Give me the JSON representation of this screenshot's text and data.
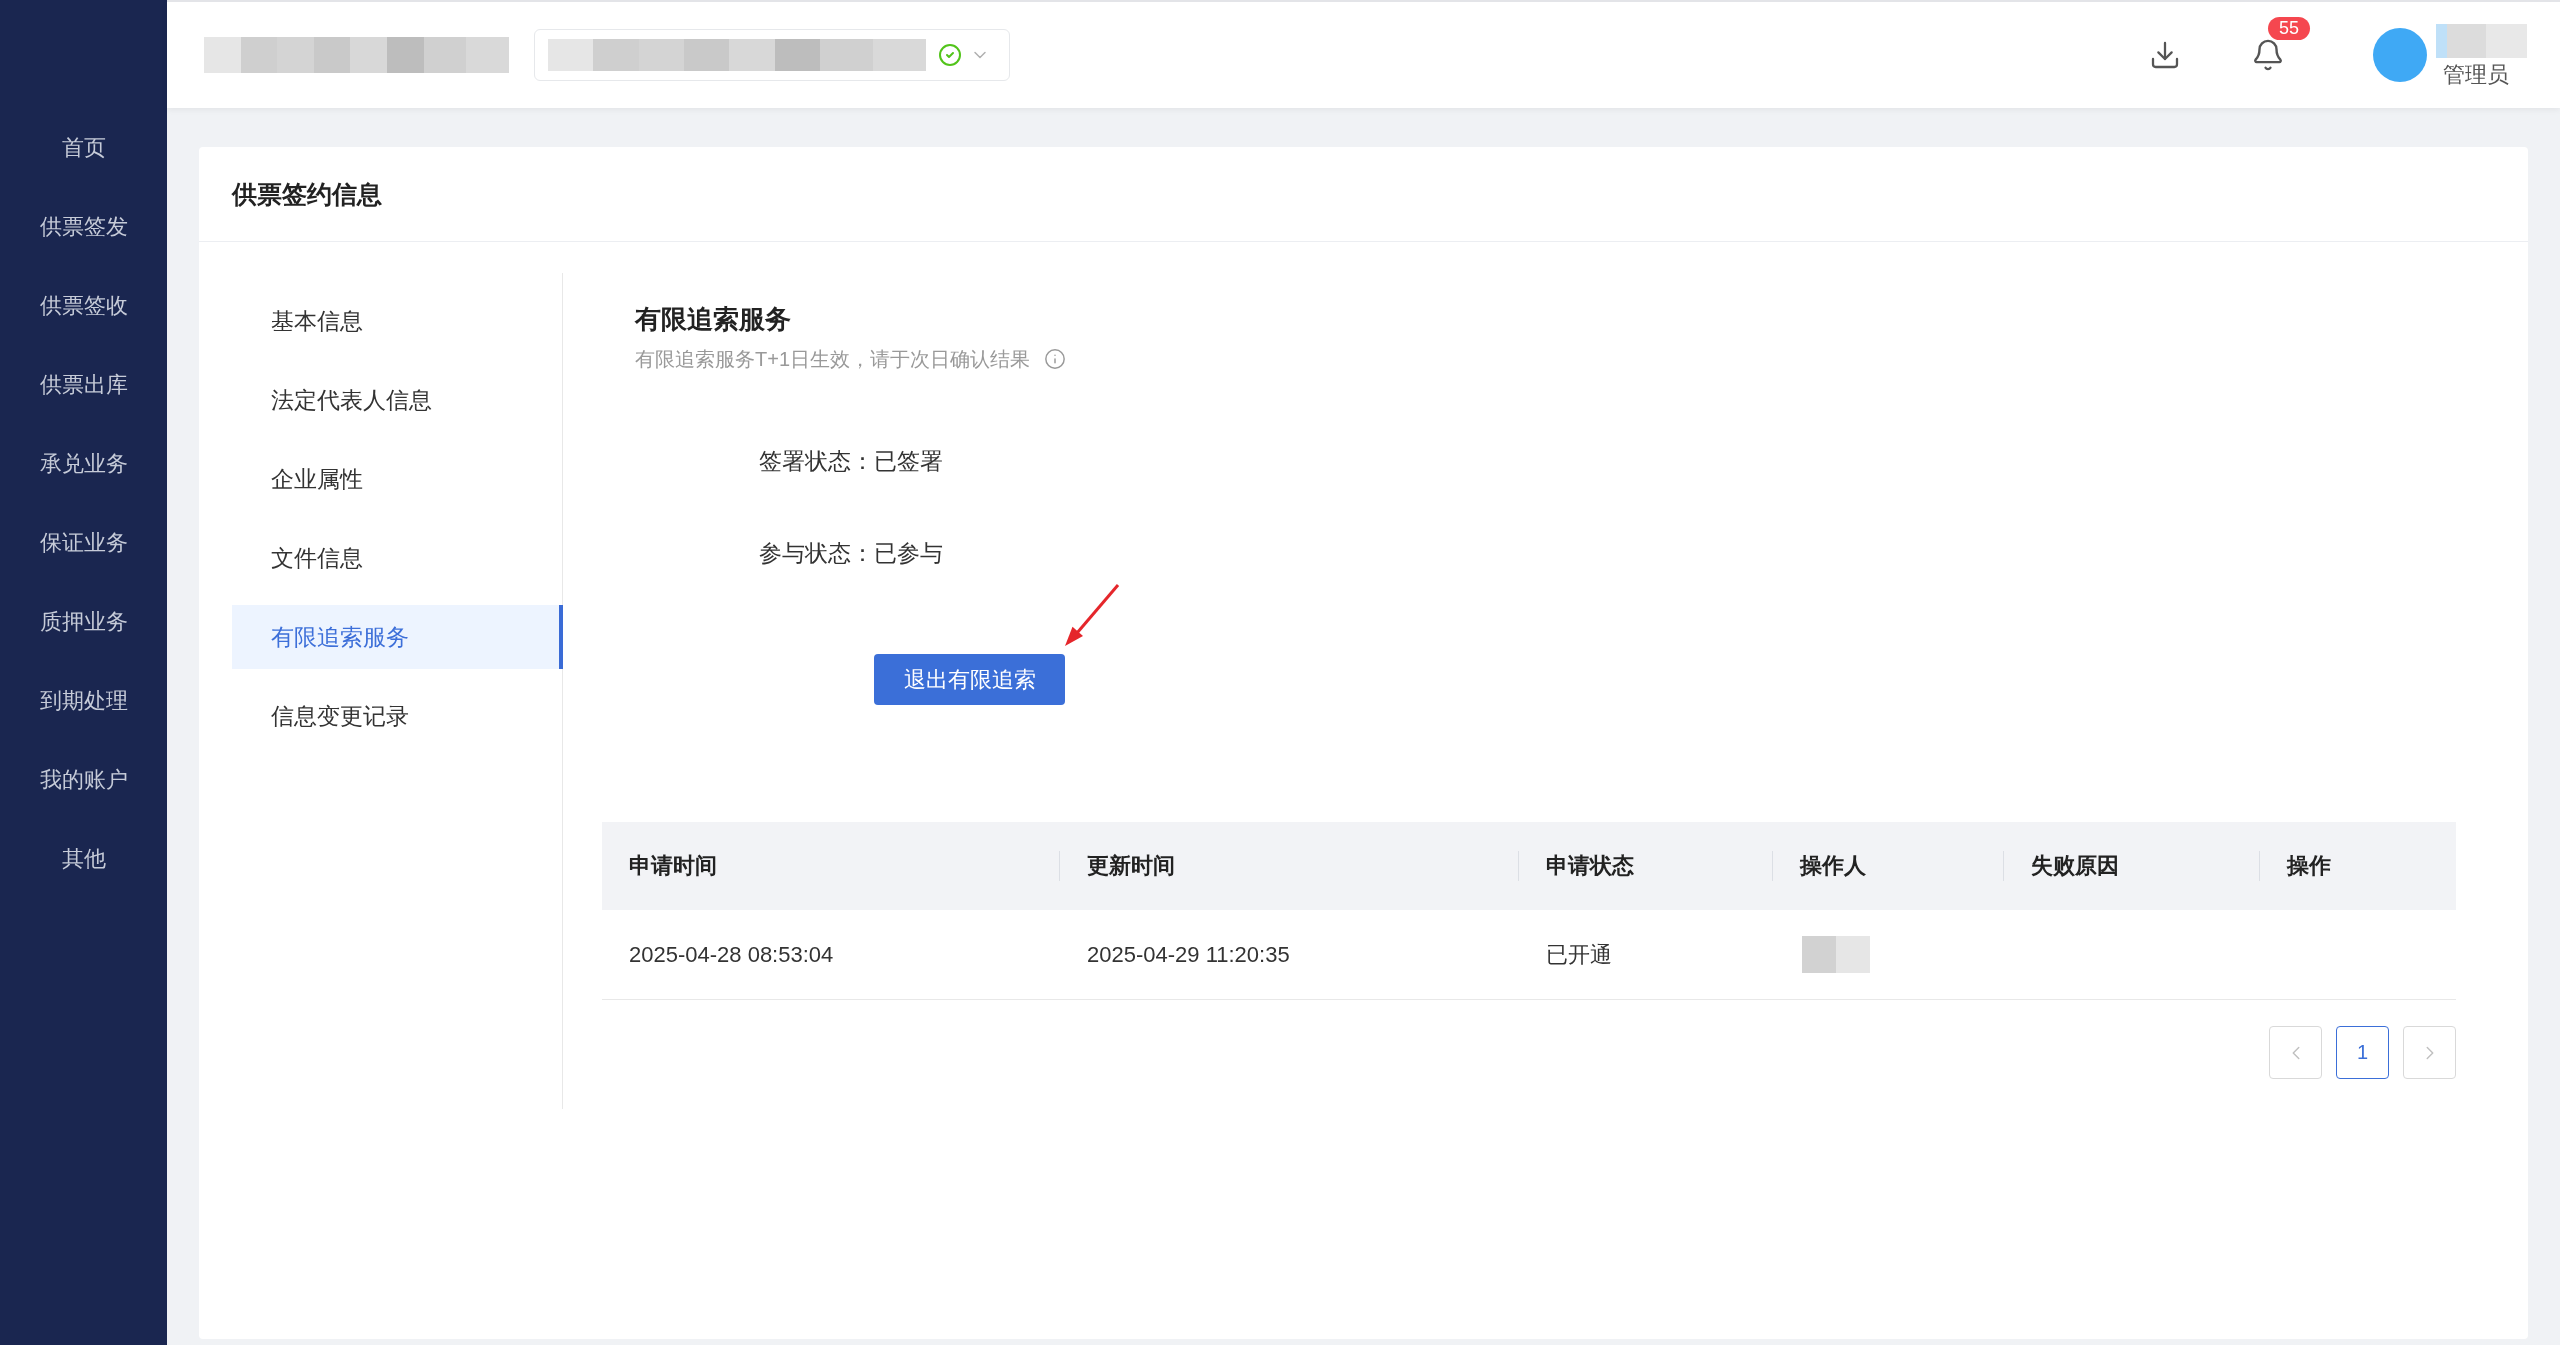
{
  "sidebar": {
    "items": [
      "首页",
      "供票签发",
      "供票签收",
      "供票出库",
      "承兑业务",
      "保证业务",
      "质押业务",
      "到期处理",
      "我的账户",
      "其他"
    ]
  },
  "header": {
    "notification_count": "55",
    "user": {
      "role": "管理员"
    }
  },
  "page": {
    "title": "供票签约信息"
  },
  "menu": {
    "items": [
      {
        "label": "基本信息",
        "selected": false
      },
      {
        "label": "法定代表人信息",
        "selected": false
      },
      {
        "label": "企业属性",
        "selected": false
      },
      {
        "label": "文件信息",
        "selected": false
      },
      {
        "label": "有限追索服务",
        "selected": true
      },
      {
        "label": "信息变更记录",
        "selected": false
      }
    ]
  },
  "section": {
    "title": "有限追索服务",
    "note": "有限追索服务T+1日生效，请于次日确认结果",
    "fields": [
      {
        "label": "签署状态：",
        "value": "已签署"
      },
      {
        "label": "参与状态：",
        "value": "已参与"
      }
    ],
    "button": "退出有限追索"
  },
  "table": {
    "columns": [
      "申请时间",
      "更新时间",
      "申请状态",
      "操作人",
      "失败原因",
      "操作"
    ],
    "rows": [
      {
        "cells": [
          "2025-04-28 08:53:04",
          "2025-04-29 11:20:35",
          "已开通"
        ],
        "operator_blurred": true
      }
    ]
  },
  "pagination": {
    "prev": {
      "disabled": true
    },
    "pages": [
      {
        "label": "1",
        "selected": true
      }
    ],
    "next": {
      "disabled": true
    }
  }
}
